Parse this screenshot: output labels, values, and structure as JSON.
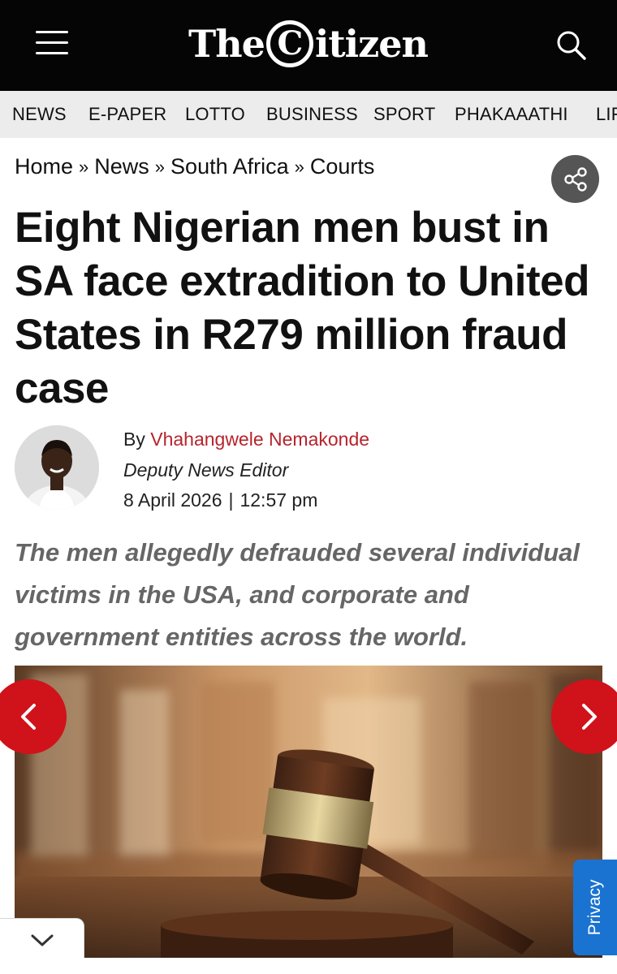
{
  "header": {
    "logo_the": "The",
    "logo_c": "C",
    "logo_rest": "itizen"
  },
  "nav": {
    "items": [
      "NEWS",
      "E-PAPER",
      "LOTTO",
      "BUSINESS",
      "SPORT",
      "PHAKAAATHI",
      "LIF"
    ]
  },
  "breadcrumb": {
    "items": [
      "Home",
      "News",
      "South Africa",
      "Courts"
    ],
    "separator": "»"
  },
  "article": {
    "headline": "Eight Nigerian men bust in SA face extradition to United States in R279 million fraud case",
    "byline_prefix": "By",
    "author": "Vhahangwele Nemakonde",
    "role": "Deputy News Editor",
    "date": "8 April 2026",
    "date_separator": "|",
    "time": "12:57 pm",
    "summary": "The men allegedly defrauded several individual victims in the USA, and corporate and government entities across the world."
  },
  "widgets": {
    "privacy_label": "Privacy"
  },
  "icons": {
    "menu": "hamburger-menu-icon",
    "search": "search-icon",
    "share": "share-icon",
    "prev": "chevron-left-icon",
    "next": "chevron-right-icon",
    "collapse": "chevron-down-icon"
  },
  "colors": {
    "header_bg": "#050505",
    "nav_bg": "#ececec",
    "author_link": "#b7232b",
    "arrow_red": "#d0121b",
    "privacy_blue": "#1a73d1",
    "share_bg": "#555555"
  }
}
